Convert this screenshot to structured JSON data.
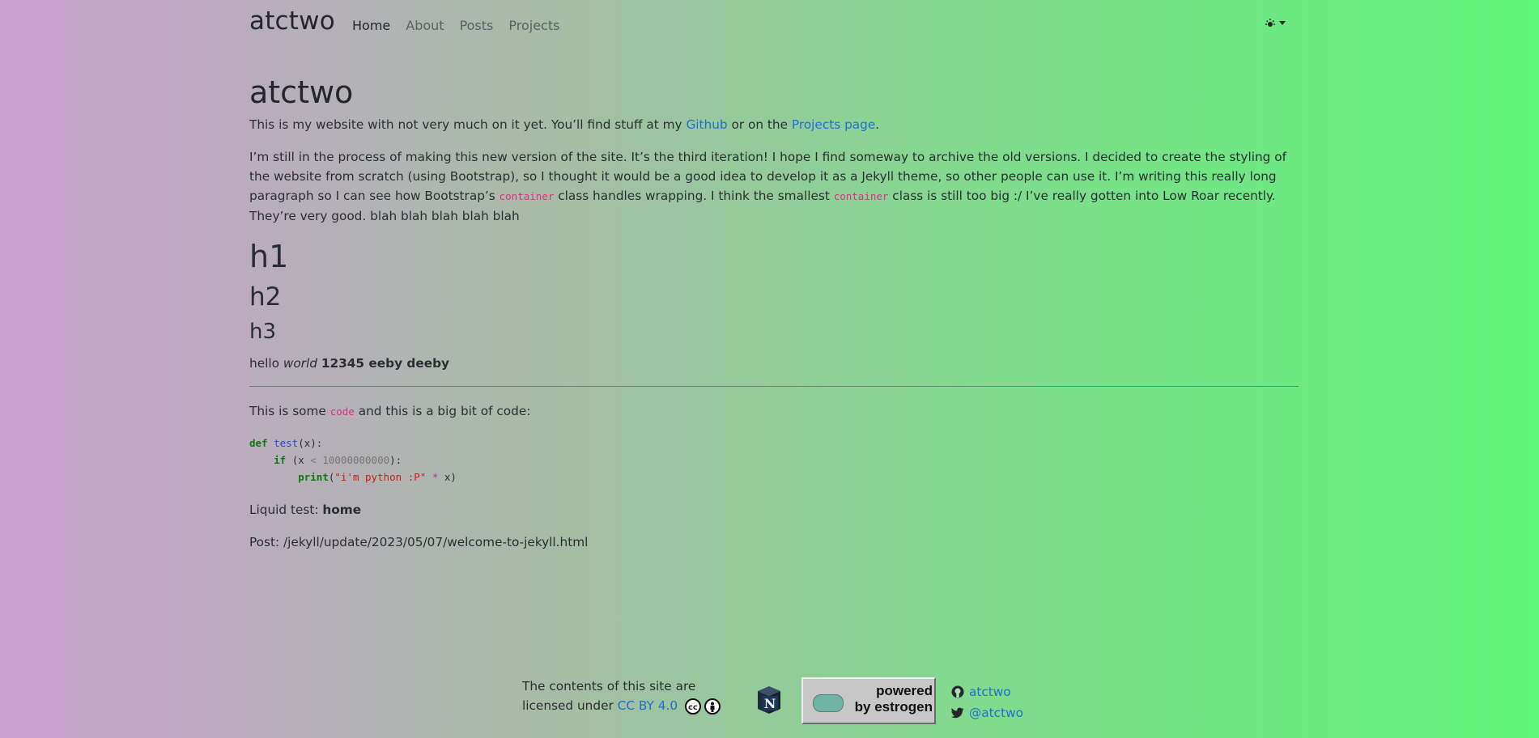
{
  "nav": {
    "brand": "atctwo",
    "links": [
      "Home",
      "About",
      "Posts",
      "Projects"
    ]
  },
  "main": {
    "title": "atctwo",
    "intro": {
      "before": "This is my website with not very much on it yet. You’ll find stuff at my ",
      "link1": "Github",
      "middle": " or on the ",
      "link2": "Projects page",
      "after": "."
    },
    "para2": {
      "p1": "I’m still in the process of making this new version of the site. It’s the third iteration! I hope I find someway to archive the old versions. I decided to create the styling of the website from scratch (using Bootstrap), so I thought it would be a good idea to develop it as a Jekyll theme, so other people can use it. I’m writing this really long paragraph so I can see how Bootstrap’s ",
      "code1": "container",
      "p2": " class handles wrapping. I think the smallest ",
      "code2": "container",
      "p3": " class is still too big :/ I’ve really gotten into Low Roar recently. They’re very good. blah blah blah blah blah"
    },
    "h1": "h1",
    "h2": "h2",
    "h3": "h3",
    "hello": {
      "plain": "hello ",
      "italic": "world",
      "bold": "12345 eeby deeby"
    },
    "code_intro": {
      "before": "This is some ",
      "code": "code",
      "after": " and this is a big bit of code:"
    },
    "code_block": {
      "l1_def": "def",
      "l1_fn": "test",
      "l1_rest": "(x):",
      "l2_indent": "    ",
      "l2_if": "if",
      "l2_a": " (x ",
      "l2_lt": "<",
      "l2_num": "10000000000",
      "l2_b": "):",
      "l3_indent": "        ",
      "l3_print": "print",
      "l3_a": "(",
      "l3_str": "\"i'm python :P\"",
      "l3_sp": " ",
      "l3_op": "*",
      "l3_b": " x)"
    },
    "liquid": {
      "label": "Liquid test: ",
      "value": "home"
    },
    "post": "Post: /jekyll/update/2023/05/07/welcome-to-jekyll.html"
  },
  "footer": {
    "license_line1": "The contents of this site are",
    "license_line2": "licensed under ",
    "license_link": "CC BY 4.0",
    "cube_letter": "N",
    "estrogen_line1": "powered",
    "estrogen_line2": "by estrogen",
    "github": "atctwo",
    "twitter": "@atctwo"
  }
}
